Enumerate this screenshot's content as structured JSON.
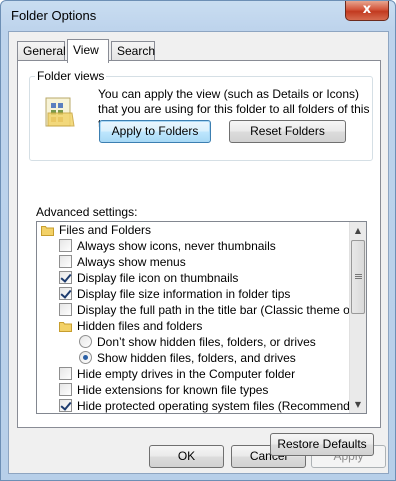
{
  "window": {
    "title": "Folder Options",
    "close_glyph": "x"
  },
  "tabs": [
    {
      "label": "General"
    },
    {
      "label": "View"
    },
    {
      "label": "Search"
    }
  ],
  "folder_views": {
    "legend": "Folder views",
    "description": "You can apply the view (such as Details or Icons) that you are using for this folder to all folders of this type.",
    "apply_label": "Apply to Folders",
    "reset_label": "Reset Folders",
    "icon": "folder-views-icon"
  },
  "advanced": {
    "label": "Advanced settings:",
    "items": [
      {
        "kind": "folder",
        "label": "Files and Folders",
        "indent": 0
      },
      {
        "kind": "checkbox",
        "label": "Always show icons, never thumbnails",
        "checked": false,
        "indent": 1
      },
      {
        "kind": "checkbox",
        "label": "Always show menus",
        "checked": false,
        "indent": 1
      },
      {
        "kind": "checkbox",
        "label": "Display file icon on thumbnails",
        "checked": true,
        "indent": 1
      },
      {
        "kind": "checkbox",
        "label": "Display file size information in folder tips",
        "checked": true,
        "indent": 1
      },
      {
        "kind": "checkbox",
        "label": "Display the full path in the title bar (Classic theme only)",
        "checked": false,
        "indent": 1
      },
      {
        "kind": "folder",
        "label": "Hidden files and folders",
        "indent": 1
      },
      {
        "kind": "radio",
        "label": "Don’t show hidden files, folders, or drives",
        "checked": false,
        "indent": 2
      },
      {
        "kind": "radio",
        "label": "Show hidden files, folders, and drives",
        "checked": true,
        "indent": 2
      },
      {
        "kind": "checkbox",
        "label": "Hide empty drives in the Computer folder",
        "checked": false,
        "indent": 1
      },
      {
        "kind": "checkbox",
        "label": "Hide extensions for known file types",
        "checked": false,
        "indent": 1
      },
      {
        "kind": "checkbox",
        "label": "Hide protected operating system files (Recommended)",
        "checked": true,
        "indent": 1
      }
    ]
  },
  "restore_label": "Restore Defaults",
  "dialog_buttons": {
    "ok": "OK",
    "cancel": "Cancel",
    "apply": "Apply"
  },
  "colors": {
    "title_bar": "#bdd3ec",
    "close_button": "#c23a20",
    "focus_border": "#3c7fb1"
  }
}
